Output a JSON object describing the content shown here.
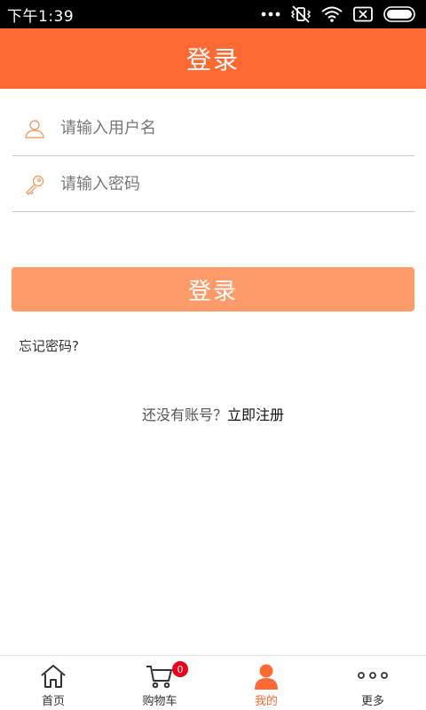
{
  "status_bar": {
    "time": "下午1:39",
    "icons": [
      "more-dots-icon",
      "vibrate-off-icon",
      "wifi-icon",
      "sim-off-icon",
      "battery-icon"
    ]
  },
  "header": {
    "title": "登录"
  },
  "form": {
    "username": {
      "placeholder": "请输入用户名",
      "value": "",
      "icon": "user-icon"
    },
    "password": {
      "placeholder": "请输入密码",
      "value": "",
      "icon": "key-icon"
    },
    "login_button_label": "登录",
    "forgot_password": "忘记密码?",
    "register_prompt": "还没有账号？",
    "register_link": "立即注册"
  },
  "tab_bar": {
    "items": [
      {
        "label": "首页",
        "icon": "home-icon"
      },
      {
        "label": "购物车",
        "icon": "cart-icon",
        "badge": "0"
      },
      {
        "label": "我的",
        "icon": "person-icon",
        "active": true
      },
      {
        "label": "更多",
        "icon": "more-icon"
      }
    ]
  },
  "colors": {
    "header_bg": "#ff6a34",
    "button_bg": "#ff9a6a",
    "active_tab": "#ff6a34",
    "badge_bg": "#e6001e",
    "field_icon": "#f0a070"
  }
}
